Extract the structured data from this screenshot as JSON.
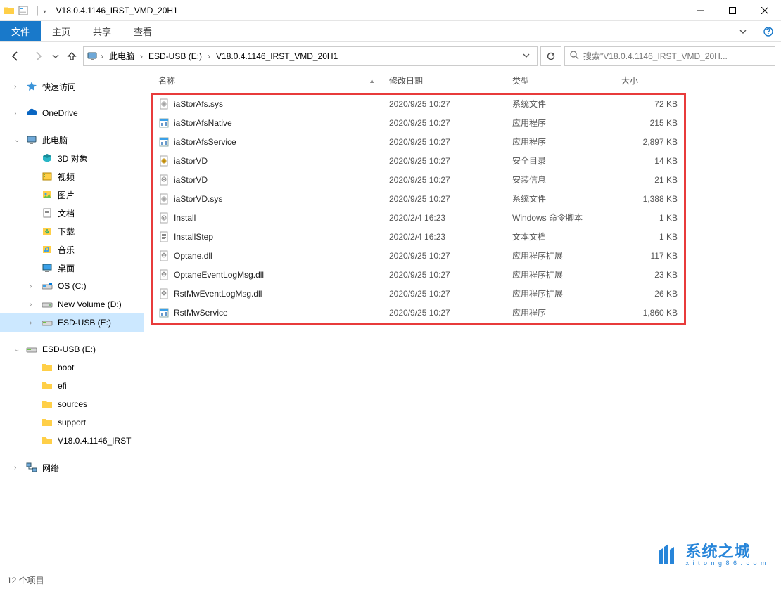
{
  "window": {
    "title": "V18.0.4.1146_IRST_VMD_20H1"
  },
  "ribbon": {
    "file": "文件",
    "tabs": [
      "主页",
      "共享",
      "查看"
    ]
  },
  "address": {
    "crumbs": [
      "此电脑",
      "ESD-USB (E:)",
      "V18.0.4.1146_IRST_VMD_20H1"
    ],
    "search_placeholder": "搜索\"V18.0.4.1146_IRST_VMD_20H..."
  },
  "columns": {
    "name": "名称",
    "date": "修改日期",
    "type": "类型",
    "size": "大小"
  },
  "sidebar": {
    "quick": "快速访问",
    "onedrive": "OneDrive",
    "thispc": "此电脑",
    "thispc_children": [
      "3D 对象",
      "视频",
      "图片",
      "文档",
      "下载",
      "音乐",
      "桌面",
      "OS (C:)",
      "New Volume (D:)",
      "ESD-USB (E:)"
    ],
    "esd": "ESD-USB (E:)",
    "esd_children": [
      "boot",
      "efi",
      "sources",
      "support",
      "V18.0.4.1146_IRST"
    ],
    "network": "网络"
  },
  "files": [
    {
      "icon": "sys",
      "name": "iaStorAfs.sys",
      "date": "2020/9/25 10:27",
      "type": "系统文件",
      "size": "72 KB"
    },
    {
      "icon": "exe",
      "name": "iaStorAfsNative",
      "date": "2020/9/25 10:27",
      "type": "应用程序",
      "size": "215 KB"
    },
    {
      "icon": "exe",
      "name": "iaStorAfsService",
      "date": "2020/9/25 10:27",
      "type": "应用程序",
      "size": "2,897 KB"
    },
    {
      "icon": "cat",
      "name": "iaStorVD",
      "date": "2020/9/25 10:27",
      "type": "安全目录",
      "size": "14 KB"
    },
    {
      "icon": "inf",
      "name": "iaStorVD",
      "date": "2020/9/25 10:27",
      "type": "安装信息",
      "size": "21 KB"
    },
    {
      "icon": "sys",
      "name": "iaStorVD.sys",
      "date": "2020/9/25 10:27",
      "type": "系统文件",
      "size": "1,388 KB"
    },
    {
      "icon": "cmd",
      "name": "Install",
      "date": "2020/2/4 16:23",
      "type": "Windows 命令脚本",
      "size": "1 KB"
    },
    {
      "icon": "txt",
      "name": "InstallStep",
      "date": "2020/2/4 16:23",
      "type": "文本文档",
      "size": "1 KB"
    },
    {
      "icon": "dll",
      "name": "Optane.dll",
      "date": "2020/9/25 10:27",
      "type": "应用程序扩展",
      "size": "117 KB"
    },
    {
      "icon": "dll",
      "name": "OptaneEventLogMsg.dll",
      "date": "2020/9/25 10:27",
      "type": "应用程序扩展",
      "size": "23 KB"
    },
    {
      "icon": "dll",
      "name": "RstMwEventLogMsg.dll",
      "date": "2020/9/25 10:27",
      "type": "应用程序扩展",
      "size": "26 KB"
    },
    {
      "icon": "exe",
      "name": "RstMwService",
      "date": "2020/9/25 10:27",
      "type": "应用程序",
      "size": "1,860 KB"
    }
  ],
  "status": {
    "count": "12 个项目"
  },
  "watermark": {
    "line1": "系统之城",
    "line2": "xitong86.com"
  }
}
